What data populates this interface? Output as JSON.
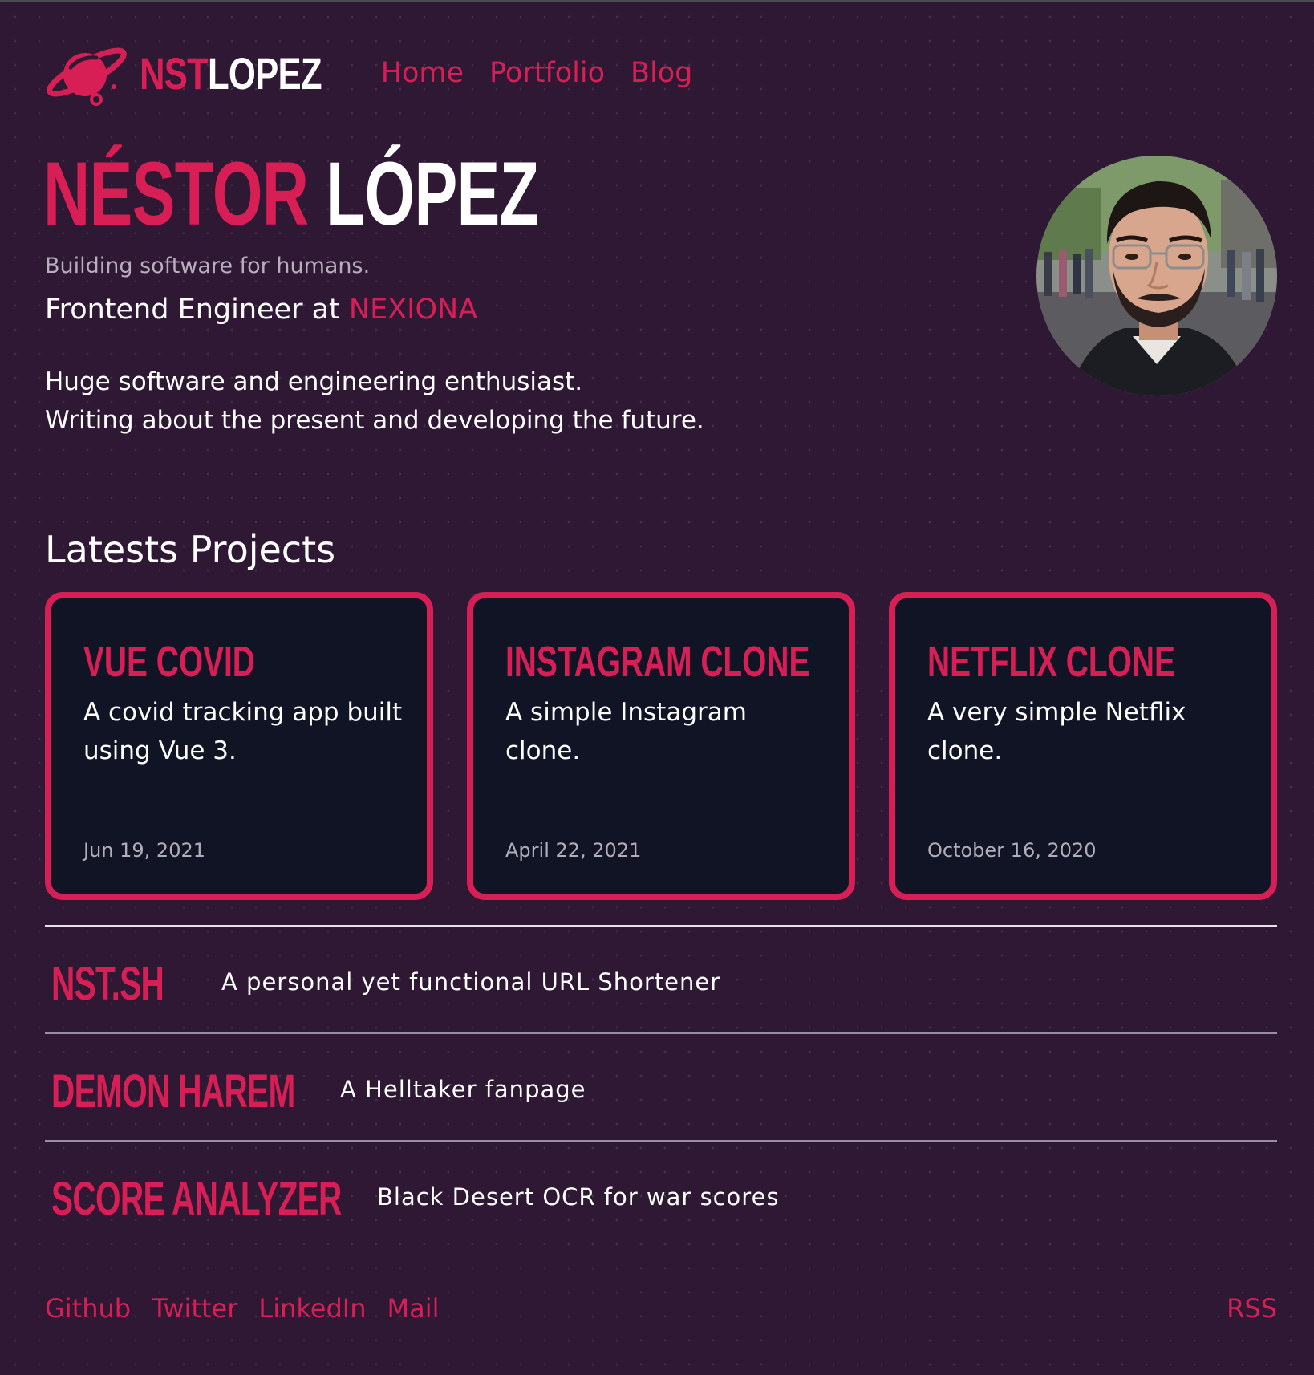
{
  "brand": {
    "logo_first": "NST",
    "logo_second": "LOPEZ",
    "icon": "planet-icon",
    "accent_color": "#d81f55",
    "background_color": "#2e1834",
    "card_background_color": "#111425"
  },
  "nav": {
    "items": [
      {
        "label": "Home"
      },
      {
        "label": "Portfolio"
      },
      {
        "label": "Blog"
      }
    ]
  },
  "hero": {
    "first_name": "NÉSTOR",
    "last_name": "LÓPEZ",
    "tagline": "Building software for humans.",
    "role_prefix": "Frontend Engineer at ",
    "company": "NEXIONA",
    "bio_line1": "Huge software and engineering enthusiast.",
    "bio_line2": "Writing about the present and developing the future."
  },
  "projects": {
    "title": "Latests Projects",
    "cards": [
      {
        "title": "VUE COVID",
        "description": "A covid tracking app built using Vue 3.",
        "date": "Jun 19, 2021"
      },
      {
        "title": "INSTAGRAM CLONE",
        "description": "A simple Instagram clone.",
        "date": "April 22, 2021"
      },
      {
        "title": "NETFLIX CLONE",
        "description": "A very simple Netflix clone.",
        "date": "October 16, 2020"
      }
    ],
    "more": [
      {
        "name": "NST.SH",
        "description": "A personal yet functional URL Shortener"
      },
      {
        "name": "DEMON HAREM",
        "description": "A Helltaker fanpage"
      },
      {
        "name": "SCORE ANALYZER",
        "description": "Black Desert OCR for war scores"
      }
    ]
  },
  "footer": {
    "links": [
      {
        "label": "Github"
      },
      {
        "label": "Twitter"
      },
      {
        "label": "LinkedIn"
      },
      {
        "label": "Mail"
      }
    ],
    "rss": "RSS"
  }
}
